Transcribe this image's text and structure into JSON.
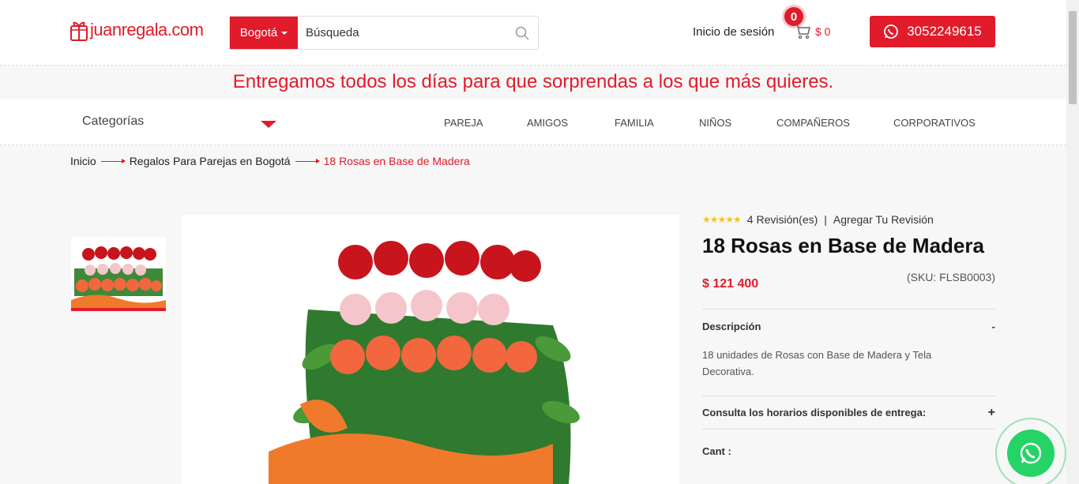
{
  "header": {
    "logo": "juanregala.com",
    "city": "Bogotá",
    "search_placeholder": "Búsqueda",
    "login_label": "Inicio de sesión",
    "cart_count": "0",
    "cart_total": "$ 0",
    "whatsapp_number": "3052249615"
  },
  "promo_banner": "Entregamos todos los días para que sorprendas a los que más quieres.",
  "nav": {
    "categories_label": "Categorías",
    "links": [
      "PAREJA",
      "AMIGOS",
      "FAMILIA",
      "NIÑOS",
      "COMPAÑEROS",
      "CORPORATIVOS"
    ]
  },
  "breadcrumb": [
    "Inicio",
    "Regalos Para Parejas en Bogotá",
    "18 Rosas en Base de Madera"
  ],
  "product": {
    "stars": 5,
    "reviews_label": "4 Revisión(es)",
    "add_review_label": "Agregar Tu Revisión",
    "title": "18 Rosas en Base de Madera",
    "price": "$ 121 400",
    "sku": "(SKU: FLSB0003)",
    "description_heading": "Descripción",
    "description_toggle": "-",
    "description_text": "18 unidades de Rosas con Base de Madera y Tela Decorativa.",
    "schedule_heading": "Consulta los horarios disponibles de entrega:",
    "schedule_toggle": "+",
    "quantity_label": "Cant :"
  },
  "colors": {
    "brand_red": "#e11b2a",
    "whatsapp_green": "#25d366",
    "star_yellow": "#f5c518"
  }
}
